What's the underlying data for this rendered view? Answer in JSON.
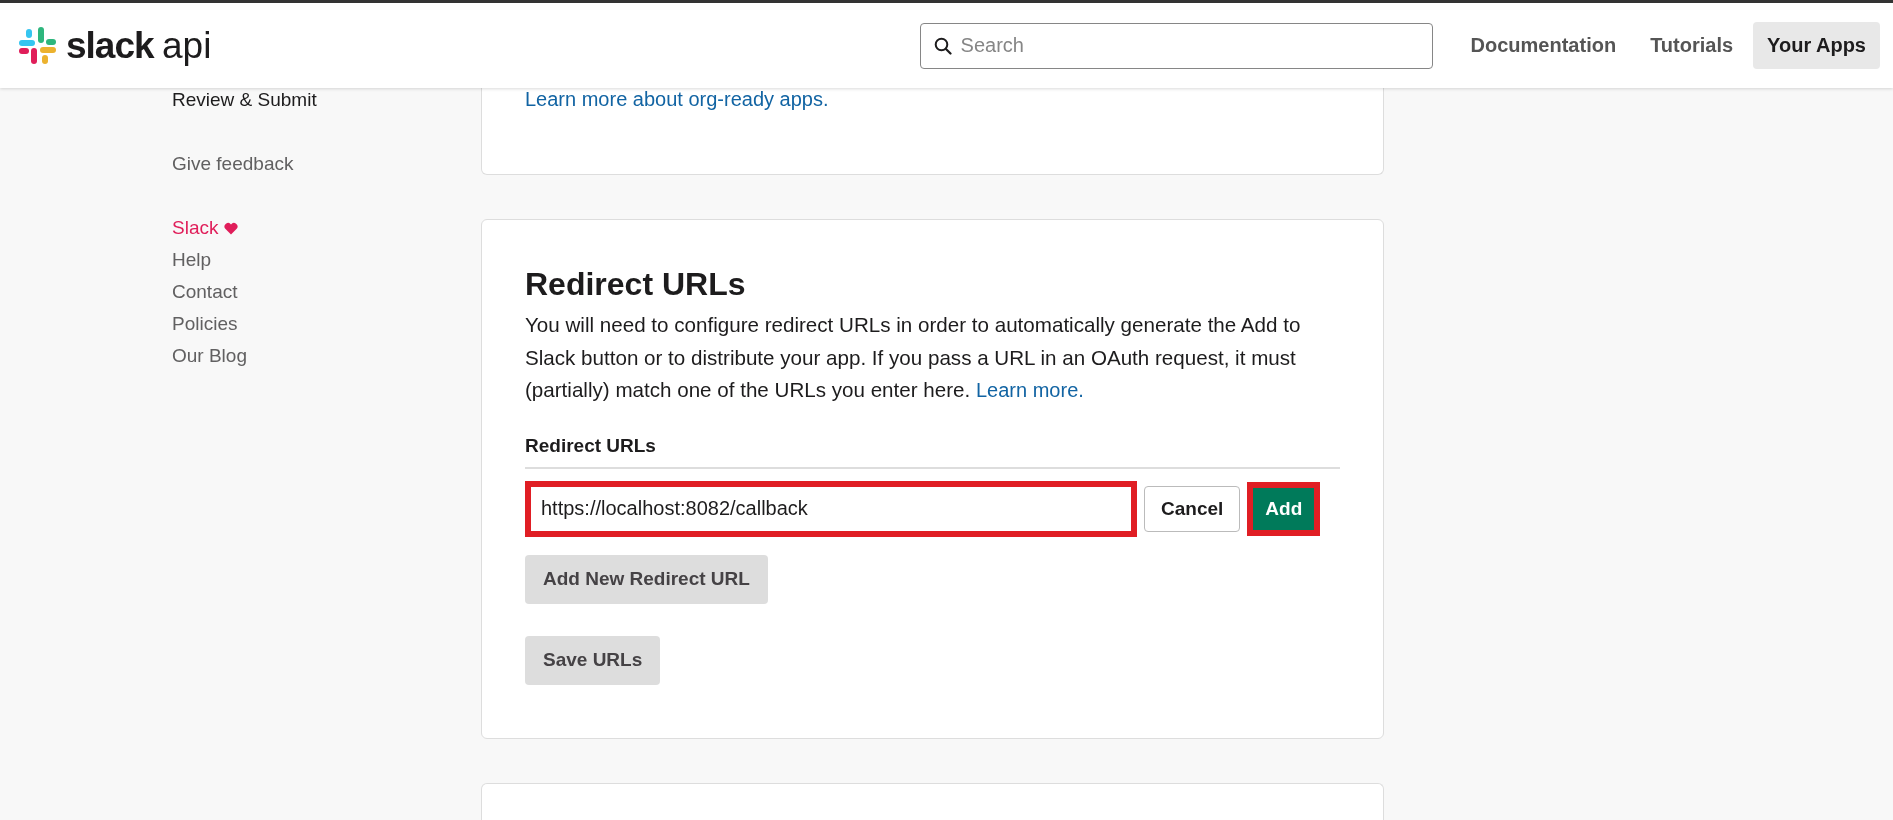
{
  "header": {
    "logo": {
      "brand": "slack",
      "product": "api"
    },
    "search": {
      "placeholder": "Search"
    },
    "nav": [
      {
        "label": "Documentation",
        "selected": false
      },
      {
        "label": "Tutorials",
        "selected": false
      },
      {
        "label": "Your Apps",
        "selected": true
      }
    ]
  },
  "sidebar": {
    "groups": [
      {
        "items": [
          {
            "label": "Review & Submit",
            "kind": "nav"
          }
        ]
      },
      {
        "items": [
          {
            "label": "Give feedback",
            "kind": "link"
          }
        ]
      },
      {
        "items": [
          {
            "label": "Slack",
            "kind": "brand"
          },
          {
            "label": "Help",
            "kind": "link"
          },
          {
            "label": "Contact",
            "kind": "link"
          },
          {
            "label": "Policies",
            "kind": "link"
          },
          {
            "label": "Our Blog",
            "kind": "link"
          }
        ]
      }
    ]
  },
  "org_card": {
    "link": "Learn more about org-ready apps."
  },
  "redirect_card": {
    "title": "Redirect URLs",
    "description": "You will need to configure redirect URLs in order to automatically generate the Add to Slack button or to distribute your app. If you pass a URL in an OAuth request, it must (partially) match one of the URLs you enter here.",
    "description_link": "Learn more.",
    "field_label": "Redirect URLs",
    "input": {
      "value": "https://localhost:8082/callback",
      "highlighted": true
    },
    "cancel_button": "Cancel",
    "add_button": {
      "label": "Add",
      "highlighted": true
    },
    "add_new_button": "Add New Redirect URL",
    "save_button": "Save URLs"
  }
}
